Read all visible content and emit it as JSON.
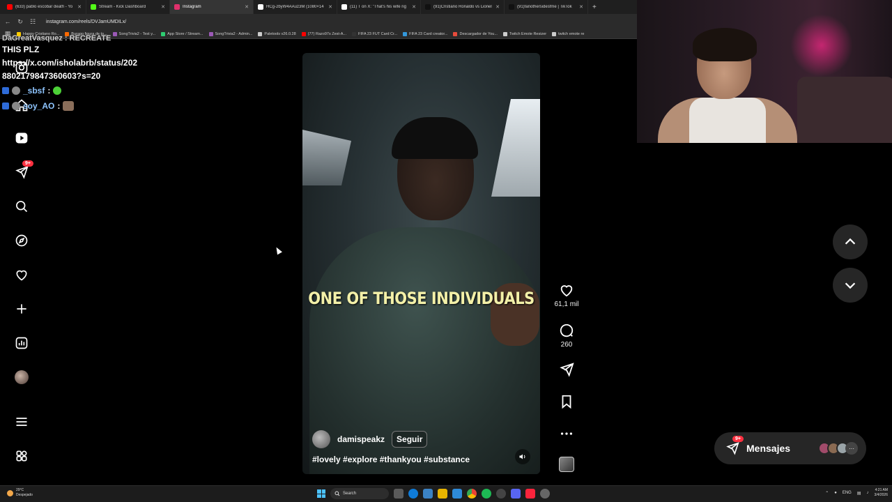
{
  "browser": {
    "tabs": [
      {
        "title": "(633) pablo escobar death - Yo",
        "color": "#ff0000",
        "active": false
      },
      {
        "title": "Stream - Kick Dashboard",
        "color": "#53fc18",
        "active": false
      },
      {
        "title": "Instagram",
        "color": "#e1306c",
        "active": true
      },
      {
        "title": "HCg-2byW4AAuz3M (1080×14",
        "color": "#ffffff",
        "active": false
      },
      {
        "title": "(11) T on X: \"That's his wife rig",
        "color": "#ffffff",
        "active": false
      },
      {
        "title": "(91)Cristiano Ronaldo vs Lionel",
        "color": "#111111",
        "active": false
      },
      {
        "title": "(91)fanothersidesfme | TikTok",
        "color": "#111111",
        "active": false
      }
    ],
    "new_tab": "+",
    "url": "instagram.com/reels/DVJamUMDILx/",
    "bookmarks": [
      {
        "label": "Happy Cristiano Ro...",
        "color": "#ffcc00"
      },
      {
        "label": "Burago figura de to...",
        "color": "#ff6a00"
      },
      {
        "label": "SongTrivia2 - Test y...",
        "color": "#9b59b6"
      },
      {
        "label": "App Store / Stream...",
        "color": "#2ecc71"
      },
      {
        "label": "SongTrivia2 - Admin...",
        "color": "#9b59b6"
      },
      {
        "label": "Paletools v26.0.28",
        "color": "#cccccc"
      },
      {
        "label": "(77) Razo97s Zest-A...",
        "color": "#ff0000"
      },
      {
        "label": "FIFA 23 FUT Card Cr...",
        "color": "#333333"
      },
      {
        "label": "FIFA 23 Card creator...",
        "color": "#3498db"
      },
      {
        "label": "Descargador de You...",
        "color": "#e74c3c"
      },
      {
        "label": "Twitch Emote Resizer",
        "color": "#cccccc"
      },
      {
        "label": "twitch emote re",
        "color": "#cccccc"
      }
    ]
  },
  "chat": {
    "top_fragment": "DaGreatVasquez : RECREATE",
    "message_line1": "THIS PLZ",
    "message_line2": "https://x.com/isholabrb/status/202",
    "message_line3": "8802179847360603?s=20",
    "lines": [
      {
        "user": "_sbsf",
        "sep": ":"
      },
      {
        "user": "soy_AO",
        "sep": ":"
      }
    ]
  },
  "nav": {
    "messages_badge": "9+"
  },
  "reel": {
    "caption_overlay": "ONE OF THOSE INDIVIDUALS",
    "author": "damispeakz",
    "follow_label": "Seguir",
    "hashtags": "#lovely #explore #thankyou #substance",
    "likes": "61,1 mil",
    "comments": "260"
  },
  "messages_pill": {
    "label": "Mensajes",
    "badge": "9+",
    "more": "···"
  },
  "taskbar": {
    "temp": "29°C",
    "weather": "Despejado",
    "search": "Search",
    "lang": "ENG",
    "time": "4:21 AM",
    "date": "3/4/2026"
  },
  "colors": {
    "accent_badge": "#ff3040",
    "panel": "#262626"
  }
}
